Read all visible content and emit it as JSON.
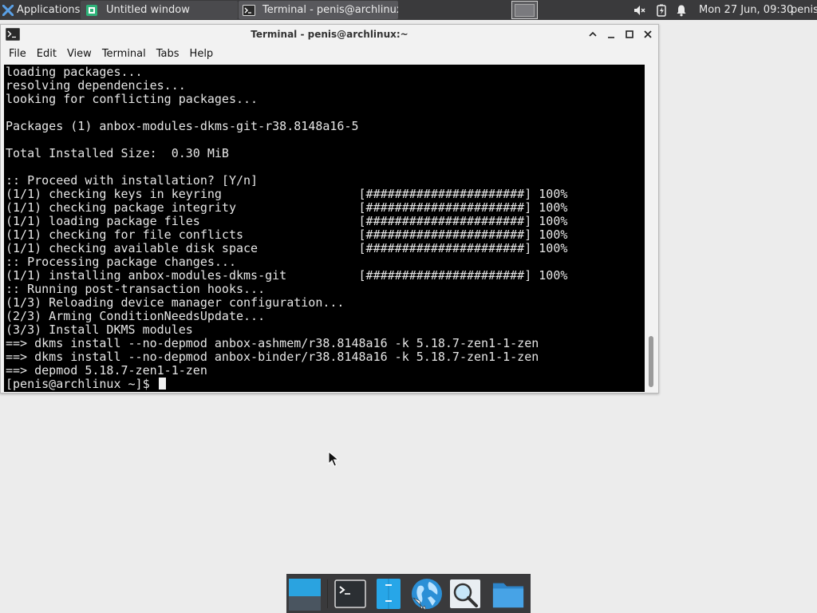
{
  "panel": {
    "applications_label": "Applications",
    "tasks": [
      {
        "label": "Untitled window",
        "icon": "mousepad-icon"
      },
      {
        "label": "Terminal - penis@archlinux:~",
        "icon": "terminal-icon"
      }
    ],
    "clock": "Mon 27 Jun, 09:30",
    "user": "penis",
    "tray_icons": [
      "speaker-muted-icon",
      "battery-icon",
      "notifications-bell-icon"
    ]
  },
  "window": {
    "title": "Terminal - penis@archlinux:~",
    "menu": [
      "File",
      "Edit",
      "View",
      "Terminal",
      "Tabs",
      "Help"
    ]
  },
  "terminal": {
    "lines": [
      "loading packages...",
      "resolving dependencies...",
      "looking for conflicting packages...",
      "",
      "Packages (1) anbox-modules-dkms-git-r38.8148a16-5",
      "",
      "Total Installed Size:  0.30 MiB",
      "",
      ":: Proceed with installation? [Y/n]",
      "(1/1) checking keys in keyring                   [######################] 100%",
      "(1/1) checking package integrity                 [######################] 100%",
      "(1/1) loading package files                      [######################] 100%",
      "(1/1) checking for file conflicts                [######################] 100%",
      "(1/1) checking available disk space              [######################] 100%",
      ":: Processing package changes...",
      "(1/1) installing anbox-modules-dkms-git          [######################] 100%",
      ":: Running post-transaction hooks...",
      "(1/3) Reloading device manager configuration...",
      "(2/3) Arming ConditionNeedsUpdate...",
      "(3/3) Install DKMS modules",
      "==> dkms install --no-depmod anbox-ashmem/r38.8148a16 -k 5.18.7-zen1-1-zen",
      "==> dkms install --no-depmod anbox-binder/r38.8148a16 -k 5.18.7-zen1-1-zen",
      "==> depmod 5.18.7-zen1-1-zen"
    ],
    "prompt": "[penis@archlinux ~]$ "
  },
  "dock": {
    "items": [
      {
        "name": "show-desktop-icon"
      },
      {
        "name": "terminal-icon"
      },
      {
        "name": "file-manager-icon"
      },
      {
        "name": "web-browser-icon"
      },
      {
        "name": "app-finder-icon"
      },
      {
        "name": "home-folder-icon"
      }
    ]
  },
  "colors": {
    "panel_bg": "#3a3a3c",
    "terminal_bg": "#000000",
    "terminal_fg": "#e6e6e6",
    "desktop_bg": "#ececec"
  }
}
